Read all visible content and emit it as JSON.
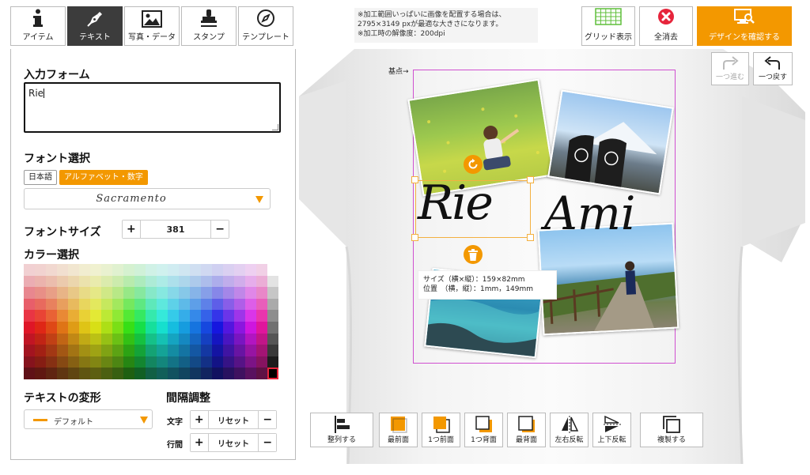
{
  "tabs": [
    {
      "label": "アイテム",
      "icon": "info-icon"
    },
    {
      "label": "テキスト",
      "icon": "pen-icon"
    },
    {
      "label": "写真・データ",
      "icon": "image-icon"
    },
    {
      "label": "スタンプ",
      "icon": "stamp-icon"
    },
    {
      "label": "テンプレート",
      "icon": "compass-icon"
    }
  ],
  "input_form": {
    "title": "入力フォーム",
    "value": "Rie"
  },
  "font": {
    "title": "フォント選択",
    "tabs": [
      "日本語",
      "アルファベット・数字"
    ],
    "selected": "Sacramento"
  },
  "font_size": {
    "title": "フォントサイズ",
    "value": "381",
    "plus": "+",
    "minus": "−"
  },
  "color": {
    "title": "カラー選択"
  },
  "transform": {
    "title": "テキストの変形",
    "selected": "デフォルト"
  },
  "spacing": {
    "title": "間隔調整",
    "rows": [
      {
        "label": "文字",
        "value": "リセット"
      },
      {
        "label": "行間",
        "value": "リセット"
      }
    ]
  },
  "notice": {
    "lines": [
      "※加工範囲いっぱいに画像を配置する場合は、",
      "2795×3149 pxが最適な大きさになります。",
      "※加工時の解像度：200dpi"
    ]
  },
  "toolbar": {
    "grid": "グリッド表示",
    "clear": "全消去",
    "confirm": "デザインを確認する",
    "redo": "一つ進む",
    "undo": "一つ戻す"
  },
  "canvas": {
    "base_point": "基点→",
    "text_main": "Rie",
    "text_second": "Ami",
    "size_info": "サイズ（横×縦）：159×82mm",
    "pos_info": "位置　（横，縦）：1mm，149mm"
  },
  "bottom_toolbar": {
    "align": "整列する",
    "front": "最前面",
    "forward": "1つ前面",
    "backward": "1つ背面",
    "back": "最背面",
    "flip_h": "左右反転",
    "flip_v": "上下反転",
    "duplicate": "複製する"
  },
  "colors": {
    "accent": "#f39800",
    "dark": "#3c3c3c",
    "print_border": "#d050d0"
  }
}
